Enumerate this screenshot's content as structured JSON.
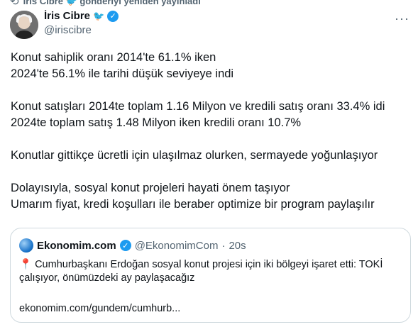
{
  "repost": {
    "text": "İris Cibre 🐦 gönderiyi yeniden yayınladı",
    "icon": "repost-icon"
  },
  "author": {
    "name": "İris Cibre",
    "emoji": "🐦",
    "handle": "@iriscibre",
    "verified": true
  },
  "more_label": "···",
  "tweet": {
    "paragraphs": [
      "Konut sahiplik oranı 2014'te 61.1% iken\n2024'te 56.1% ile tarihi düşük seviyeye indi",
      "Konut satışları 2014te toplam 1.16 Milyon ve kredili satış oranı 33.4% idi\n2024te toplam satış 1.48 Milyon iken kredili oranı 10.7%",
      "Konutlar gittikçe ücretli için ulaşılmaz olurken, sermayede yoğunlaşıyor",
      "Dolayısıyla, sosyal konut projeleri hayati önem taşıyor\nUmarım fiyat, kredi koşulları ile beraber optimize bir program paylaşılır"
    ]
  },
  "quote": {
    "name": "Ekonomim.com",
    "handle": "@EkonomimCom",
    "separator": "·",
    "time": "20s",
    "text": "📍 Cumhurbaşkanı Erdoğan sosyal konut projesi için iki bölgeyi işaret etti: TOKİ çalışıyor, önümüzdeki ay paylaşacağız",
    "link": "ekonomim.com/gundem/cumhurb..."
  },
  "colors": {
    "accent": "#1d9bf0",
    "secondary_text": "#536471",
    "border": "#cfd9de"
  }
}
